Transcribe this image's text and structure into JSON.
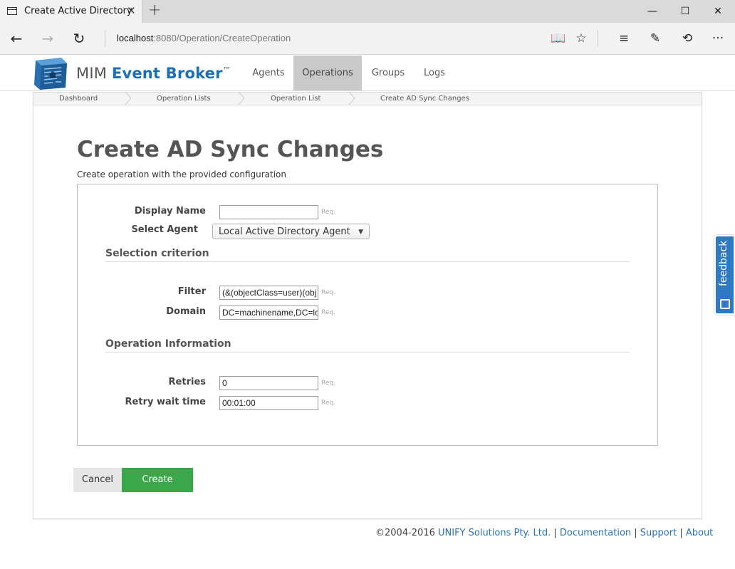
{
  "browser": {
    "tab_title": "Create Active Directory",
    "tab_close": "✕",
    "new_tab": "+",
    "window_controls": {
      "minimize": "—",
      "maximize": "☐",
      "close": "✕"
    },
    "url_host": "localhost",
    "url_rest": ":8080/Operation/CreateOperation",
    "nav": {
      "back": "←",
      "forward": "→",
      "refresh": "↻"
    },
    "tools": {
      "reading_view": "📖",
      "favorite": "☆",
      "hub": "≡",
      "notes": "✎",
      "share": "⟲",
      "more": "···"
    }
  },
  "app": {
    "brand_prefix": "MIM ",
    "brand_bold": "Event Broker",
    "brand_tm": "™",
    "menu": [
      "Agents",
      "Operations",
      "Groups",
      "Logs"
    ],
    "active_menu": "Operations"
  },
  "breadcrumb": [
    "Dashboard",
    "Operation Lists",
    "Operation List",
    "Create AD Sync Changes"
  ],
  "page": {
    "title": "Create AD Sync Changes",
    "subtitle": "Create operation with the provided configuration"
  },
  "form": {
    "display_name": {
      "label": "Display Name",
      "value": "",
      "req": "Req."
    },
    "select_agent": {
      "label": "Select Agent",
      "value": "Local Active Directory Agent"
    },
    "section_selection": "Selection criterion",
    "filter": {
      "label": "Filter",
      "value": "(&(objectClass=user)(obj",
      "req": "Req."
    },
    "domain": {
      "label": "Domain",
      "value": "DC=machinename,DC=lo",
      "req": "Req."
    },
    "section_operation": "Operation Information",
    "retries": {
      "label": "Retries",
      "value": "0",
      "req": "Req."
    },
    "retry_wait": {
      "label": "Retry wait time",
      "value": "00:01:00",
      "req": "Req."
    }
  },
  "buttons": {
    "cancel": "Cancel",
    "create": "Create"
  },
  "footer": {
    "copyright": "©2004-2016 ",
    "company": "UNIFY Solutions Pty. Ltd.",
    "sep": " | ",
    "links": [
      "Documentation",
      "Support",
      "About"
    ]
  },
  "feedback": {
    "label": "feedback"
  },
  "colors": {
    "brand_blue": "#1a6fb5",
    "create_green": "#3aa74a",
    "feedback_blue": "#2e79c4",
    "link": "#2a72b5"
  }
}
